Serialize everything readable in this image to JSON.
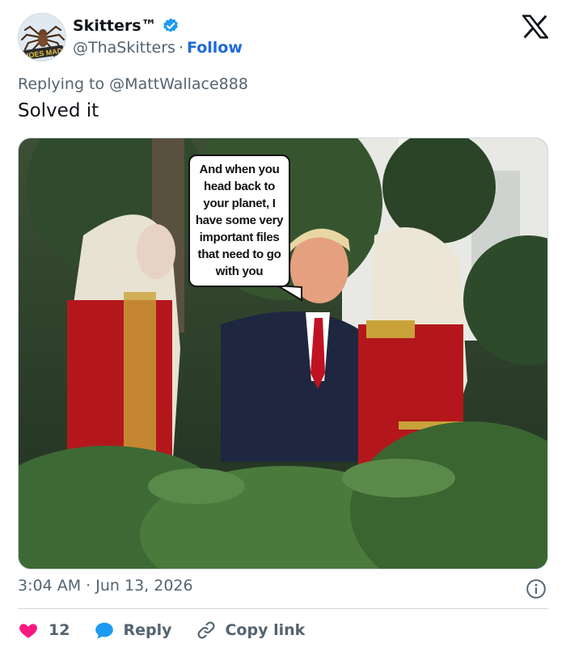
{
  "author": {
    "display_name": "Skitters™",
    "handle": "@ThaSkitters",
    "separator": "·",
    "follow_label": "Follow",
    "avatar_text": "HOES MAD",
    "verified_color": "#1d9bf0"
  },
  "reply_context": {
    "prefix": "Replying to",
    "mention": "@MattWallace888"
  },
  "tweet": {
    "text": "Solved it",
    "image_caption": [
      "And when you",
      "head back to",
      "your planet, I",
      "have some very",
      "important files",
      "that need to go",
      "with you"
    ]
  },
  "meta": {
    "time": "3:04 AM",
    "separator": "·",
    "date": "Jun 13, 2026"
  },
  "actions": {
    "like_count": "12",
    "reply_label": "Reply",
    "copy_label": "Copy link",
    "like_color": "#f91880",
    "reply_color": "#1d9bf0"
  },
  "icons": {
    "close": "x-logo-icon",
    "info": "info-icon",
    "like": "heart-icon",
    "reply": "speech-bubble-icon",
    "copy": "link-icon"
  }
}
